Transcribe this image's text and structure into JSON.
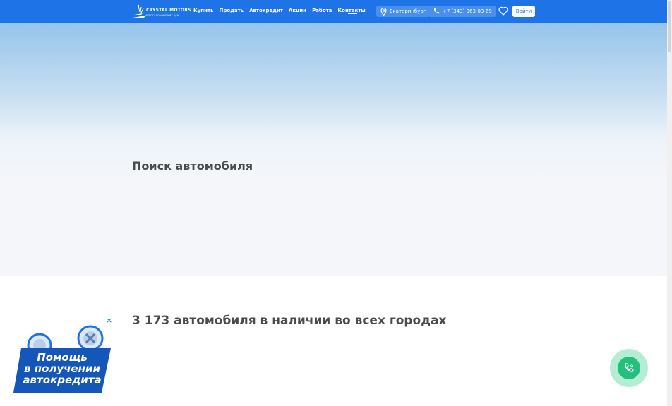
{
  "header": {
    "logo": {
      "name": "CRYSTAL MOTORS",
      "tagline": "АВТОСАЛОН НИЗКИХ ЦЕН"
    },
    "nav": [
      {
        "label": "Купить"
      },
      {
        "label": "Продать"
      },
      {
        "label": "Автокредит"
      },
      {
        "label": "Акции"
      },
      {
        "label": "Работа"
      },
      {
        "label": "Контакты"
      }
    ],
    "city": "Екатеринбург",
    "phone": "+7 (343) 363-03-69",
    "login": "Войти"
  },
  "hero": {
    "title": "Поиск автомобиля"
  },
  "listing": {
    "count_text": "3 173 автомобиля в наличии во всех городах"
  },
  "promo": {
    "line1": "Помощь",
    "line2": "в получении",
    "line3": "автокредита",
    "close": "×"
  },
  "colors": {
    "header": "#1e73e6",
    "accent": "#22c07a",
    "text": "#4b4b4b"
  },
  "icons": {
    "burger": "menu-icon",
    "city": "location-pin-icon",
    "phone": "phone-icon",
    "fav": "heart-icon",
    "call": "phone-call-icon"
  }
}
